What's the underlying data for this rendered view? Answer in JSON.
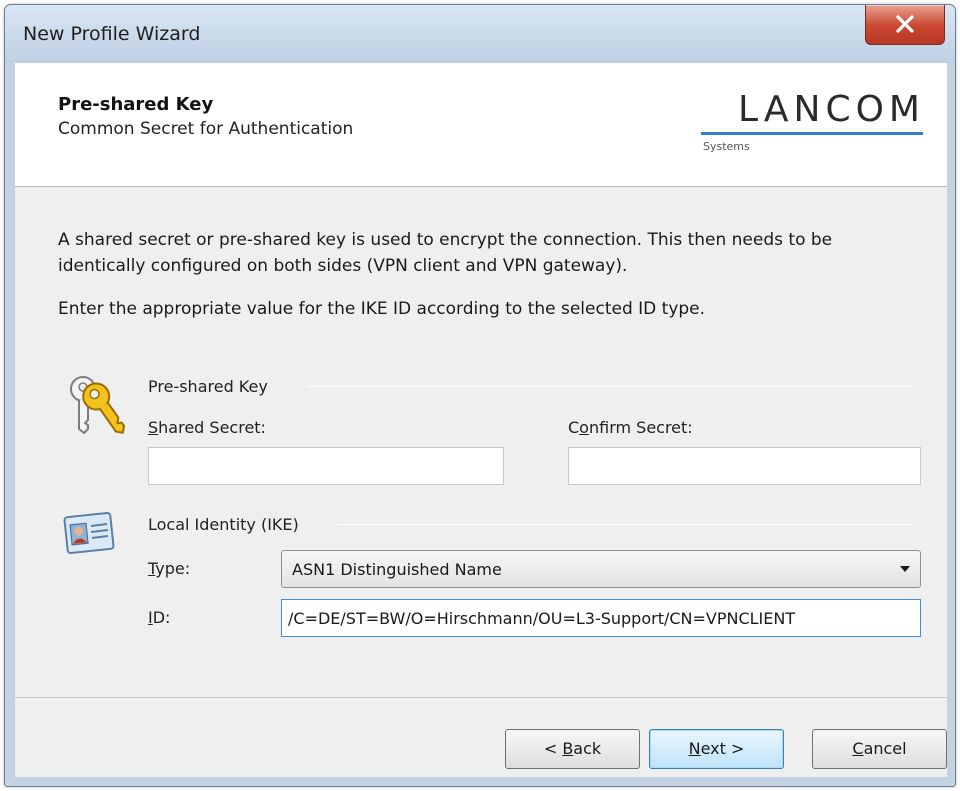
{
  "window": {
    "title": "New Profile Wizard"
  },
  "header": {
    "title": "Pre-shared Key",
    "subtitle": "Common Secret for Authentication",
    "logo_text": "LANCOM",
    "logo_subtext": "Systems"
  },
  "content": {
    "intro_line1": "A shared secret or pre-shared key is used to encrypt the connection. This then needs to be identically configured on both sides (VPN client and VPN gateway).",
    "intro_line2": "Enter the appropriate value for the IKE ID according to the selected ID type.",
    "psk_group": {
      "label": "Pre-shared Key",
      "icon": "key-icon",
      "shared_secret": {
        "label_access": "S",
        "label_rest": "hared Secret:",
        "value": ""
      },
      "confirm_secret": {
        "label_pre": "C",
        "label_access": "o",
        "label_rest": "nfirm Secret:",
        "value": ""
      }
    },
    "identity_group": {
      "label": "Local Identity (IKE)",
      "icon": "id-card-icon",
      "type": {
        "label_access": "T",
        "label_rest": "ype:",
        "selected": "ASN1 Distinguished Name"
      },
      "id": {
        "label_access": "I",
        "label_rest": "D:",
        "value": "/C=DE/ST=BW/O=Hirschmann/OU=L3-Support/CN=VPNCLIENT"
      }
    }
  },
  "buttons": {
    "back": {
      "pre": "< ",
      "access": "B",
      "rest": "ack"
    },
    "next": {
      "access": "N",
      "rest": "ext >"
    },
    "cancel": {
      "access": "C",
      "rest": "ancel"
    }
  },
  "colors": {
    "accent": "#3a7ec4",
    "close_button": "#c9462e",
    "input_focus": "#3a8ee6"
  }
}
